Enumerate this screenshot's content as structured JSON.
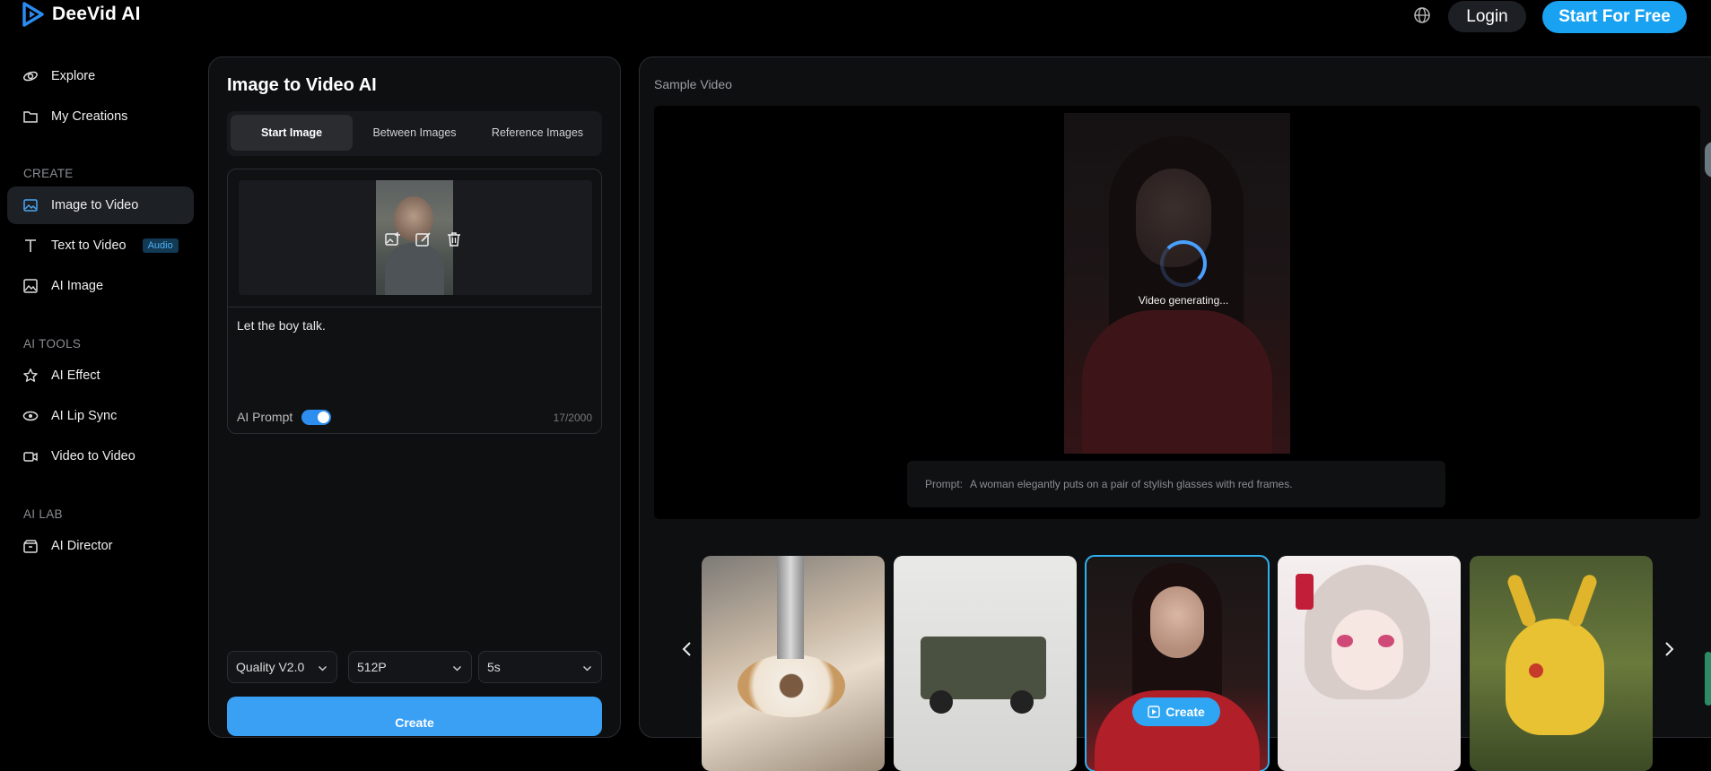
{
  "header": {
    "brand": "DeeVid AI",
    "login_label": "Login",
    "start_label": "Start For Free"
  },
  "sidebar": {
    "explore": "Explore",
    "my_creations": "My Creations",
    "section_create": "CREATE",
    "image_to_video": "Image to Video",
    "text_to_video": "Text to Video",
    "audio_badge": "Audio",
    "ai_image": "AI Image",
    "section_tools": "AI TOOLS",
    "ai_effect": "AI Effect",
    "ai_lip_sync": "AI Lip Sync",
    "video_to_video": "Video to Video",
    "section_lab": "AI LAB",
    "ai_director": "AI Director"
  },
  "panel": {
    "title": "Image to Video AI",
    "tabs": [
      "Start Image",
      "Between Images",
      "Reference Images"
    ],
    "prompt_value": "Let the boy talk.",
    "ai_prompt_label": "AI Prompt",
    "counter": "17/2000",
    "quality": "Quality V2.0",
    "resolution": "512P",
    "duration": "5s",
    "create_label": "Create"
  },
  "preview": {
    "sample_label": "Sample Video",
    "generating": "Video generating...",
    "prompt_label": "Prompt:",
    "prompt_text": "A woman elegantly puts on a pair of stylish glasses with red frames."
  },
  "gallery": {
    "create_label": "Create"
  },
  "colors": {
    "accent": "#1aa2f2",
    "background": "#000000",
    "panel": "#0e0f11"
  }
}
